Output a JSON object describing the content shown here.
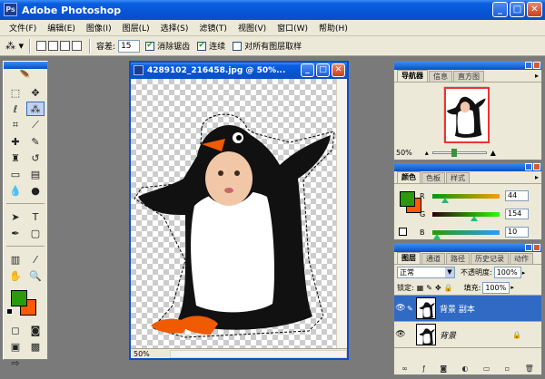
{
  "app": {
    "title": "Adobe Photoshop"
  },
  "menu": [
    "文件(F)",
    "编辑(E)",
    "图像(I)",
    "图层(L)",
    "选择(S)",
    "滤镜(T)",
    "视图(V)",
    "窗口(W)",
    "帮助(H)"
  ],
  "options": {
    "tolerance_label": "容差:",
    "tolerance_value": "15",
    "antialias_label": "消除锯齿",
    "contiguous_label": "连续",
    "all_layers_label": "对所有图层取样"
  },
  "document": {
    "title": "4289102_216458.jpg @ 50%...",
    "zoom": "50%"
  },
  "navigator": {
    "tabs": [
      "导航器",
      "信息",
      "直方图"
    ],
    "zoom": "50%"
  },
  "color": {
    "tabs": [
      "颜色",
      "色板",
      "样式"
    ],
    "r_label": "R",
    "r_value": "44",
    "g_label": "G",
    "g_value": "154",
    "b_label": "B",
    "b_value": "10",
    "fg_hex": "#2c9a0a",
    "bg_hex": "#ff5a00"
  },
  "layers": {
    "tabs": [
      "图层",
      "通道",
      "路径",
      "历史记录",
      "动作"
    ],
    "blend_mode": "正常",
    "opacity_label": "不透明度:",
    "opacity_value": "100%",
    "lock_label": "锁定:",
    "fill_label": "填充:",
    "fill_value": "100%",
    "items": [
      {
        "name": "背景 副本",
        "selected": true
      },
      {
        "name": "背景",
        "selected": false
      }
    ]
  }
}
